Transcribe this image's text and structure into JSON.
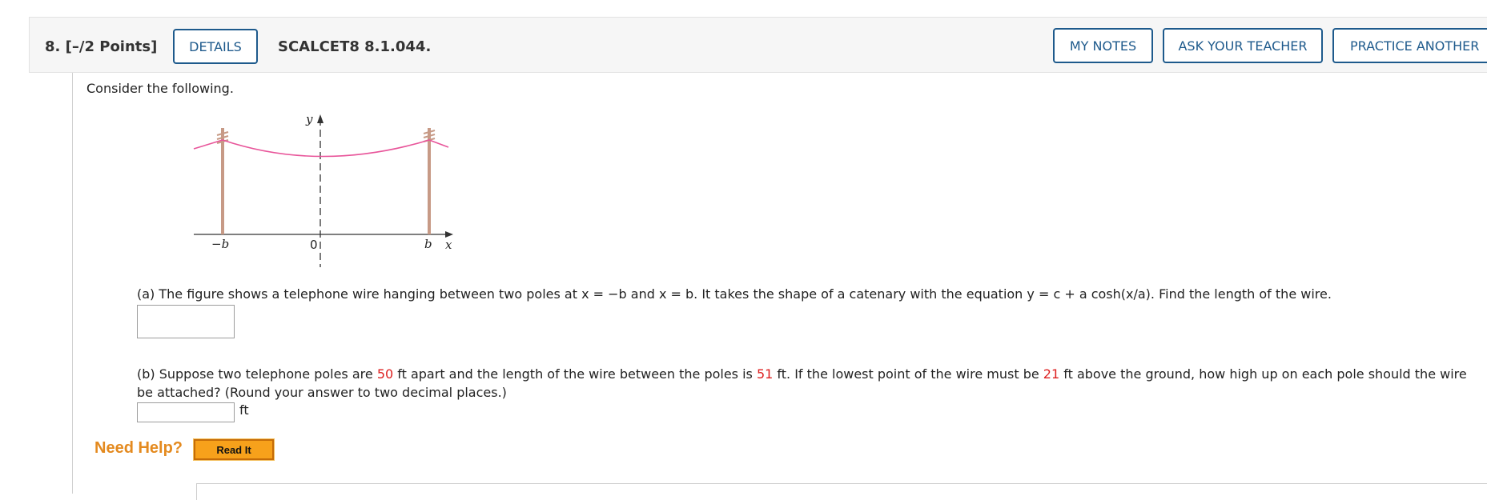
{
  "question": {
    "number": "8.",
    "points": "[–/2 Points]",
    "code": "SCALCET8 8.1.044."
  },
  "buttons": {
    "details": "DETAILS",
    "my_notes": "MY NOTES",
    "ask_teacher": "ASK YOUR TEACHER",
    "practice_another": "PRACTICE ANOTHER"
  },
  "intro": "Consider the following.",
  "figure": {
    "y_label": "y",
    "x_label": "x",
    "neg_b": "−b",
    "origin": "0",
    "b": "b"
  },
  "part_a": {
    "text": "(a) The figure shows a telephone wire hanging between two poles at x = −b and x = b. It takes the shape of a catenary with the equation  y = c + a cosh(x/a).  Find the length of the wire.",
    "answer_value": ""
  },
  "part_b": {
    "text_1": "(b) Suppose two telephone poles are ",
    "distance": "50",
    "text_2": " ft apart and the length of the wire between the poles is ",
    "length": "51",
    "text_3": " ft. If the lowest point of the wire must be ",
    "height": "21",
    "text_4": " ft above the ground, how high up on each pole should the wire be attached? (Round your answer to two decimal places.)",
    "answer_value": "",
    "unit": "ft"
  },
  "help": {
    "label": "Need Help?",
    "read_it": "Read It"
  },
  "colors": {
    "button_border": "#1e5a8c",
    "highlight_red": "#dd1f1f",
    "need_help_orange": "#e48a1f",
    "wire_pink": "#e8559a",
    "pole_tan": "#c79a86"
  }
}
